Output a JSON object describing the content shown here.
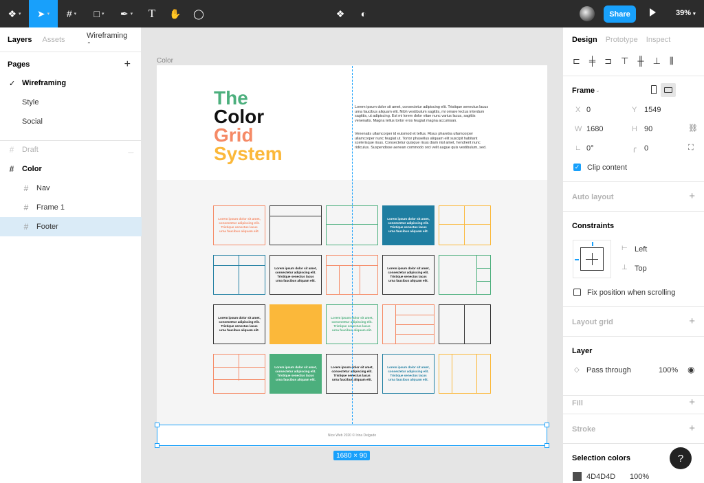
{
  "toolbar": {
    "zoom": "39%",
    "share_label": "Share",
    "tools": [
      "figma-menu-icon",
      "move-tool-icon",
      "frame-tool-icon",
      "shape-tool-icon",
      "pen-tool-icon",
      "text-tool-icon",
      "hand-tool-icon",
      "comment-tool-icon"
    ]
  },
  "left_panel": {
    "tabs": {
      "layers": "Layers",
      "assets": "Assets",
      "page_dropdown": "Wireframing"
    },
    "pages_title": "Pages",
    "pages": [
      "Wireframing",
      "Style",
      "Social"
    ],
    "layers": [
      {
        "label": "Draft"
      },
      {
        "label": "Color"
      },
      {
        "label": "Nav"
      },
      {
        "label": "Frame 1"
      },
      {
        "label": "Footer"
      }
    ]
  },
  "canvas": {
    "frame_label": "Color",
    "hero": {
      "line1": "The",
      "line2": "Color",
      "line3": "Grid",
      "line4": "System"
    },
    "paragraph1": "Lorem ipsum dolor sit amet, consectetur adipiscing elit. Tristique senectus lacus urna faucibus aliquam elit. Nibh vestibulum sagittis, mi ornare lectus interdum sagittis, ut adipiscing. Est mi lorem dolor vitae nunc varius lacus, sagittis venenatis. Magna tellus tortor eros feugiat magna accumsan.",
    "paragraph2": "Venenatis ullamcorper id euismod et tellus. Risus pharetra ullamcorper ullamcorper nunc feugiat ut. Tortor phasellus aliquam elit suscipit habitant scelerisque risus. Consectetur quisque risus diam nisl amet, hendrerit nunc ridiculus. Suspendisse aenean commodo orci velit augue quis vestibulum, sed.",
    "card_text": "Lorem ipsum dolor sit amet, consectetur adipiscing elit. Tristique senectus lacus urna faucibus aliquam elit.",
    "footer_text": "Nice Web 2020 © Irina Delgado",
    "dimensions": "1680 × 90"
  },
  "right_panel": {
    "tabs": {
      "design": "Design",
      "prototype": "Prototype",
      "inspect": "Inspect"
    },
    "frame": {
      "title": "Frame",
      "x_label": "X",
      "x": "0",
      "y_label": "Y",
      "y": "1549",
      "w_label": "W",
      "w": "1680",
      "h_label": "H",
      "h": "90",
      "rotation": "0°",
      "radius": "0",
      "clip_label": "Clip content"
    },
    "auto_layout": "Auto layout",
    "constraints": {
      "title": "Constraints",
      "horizontal": "Left",
      "vertical": "Top",
      "fix_label": "Fix position when scrolling"
    },
    "layout_grid": "Layout grid",
    "layer": {
      "title": "Layer",
      "blend": "Pass through",
      "opacity": "100%"
    },
    "fill": "Fill",
    "stroke": "Stroke",
    "selection_colors": {
      "title": "Selection colors",
      "hex": "4D4D4D",
      "opacity": "100%",
      "swatch": "#4D4D4D"
    }
  },
  "colors": {
    "accent": "#18a0fb",
    "green": "#4caf7d",
    "black": "#111111",
    "coral": "#f58a66",
    "yellow": "#fbb83a",
    "teal": "#1f7ea1"
  },
  "help_label": "?"
}
